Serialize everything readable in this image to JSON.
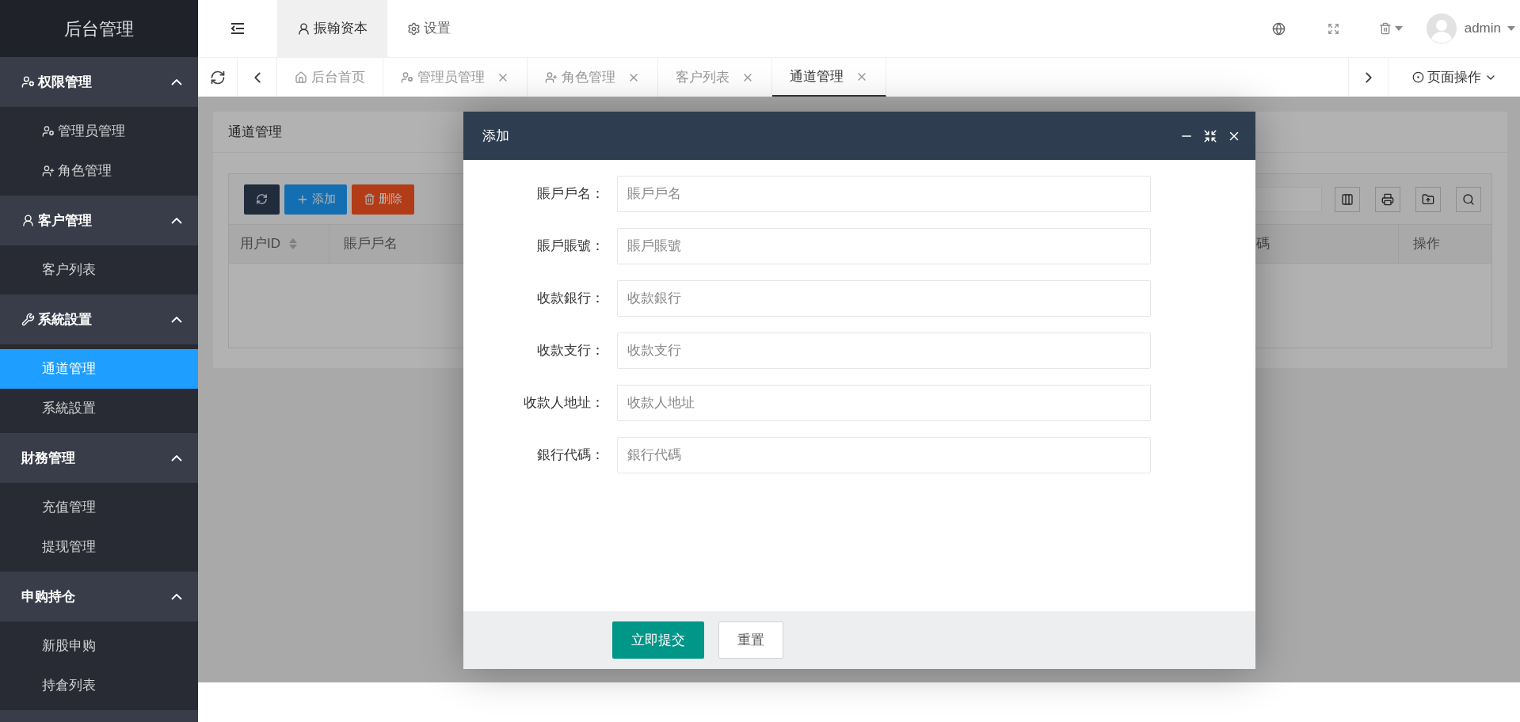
{
  "sidebar": {
    "logo": "后台管理",
    "groups": [
      {
        "label": "权限管理",
        "expanded": true,
        "items": [
          {
            "label": "管理员管理",
            "selected": false
          },
          {
            "label": "角色管理",
            "selected": false
          }
        ]
      },
      {
        "label": "客户管理",
        "expanded": true,
        "items": [
          {
            "label": "客户列表",
            "selected": false
          }
        ]
      },
      {
        "label": "系統設置",
        "expanded": true,
        "items": [
          {
            "label": "通道管理",
            "selected": true
          },
          {
            "label": "系統設置",
            "selected": false
          }
        ]
      },
      {
        "label": "財務管理",
        "expanded": true,
        "items": [
          {
            "label": "充值管理",
            "selected": false
          },
          {
            "label": "提现管理",
            "selected": false
          }
        ]
      },
      {
        "label": "申购持仓",
        "expanded": true,
        "items": [
          {
            "label": "新股申购",
            "selected": false
          },
          {
            "label": "持倉列表",
            "selected": false
          }
        ]
      }
    ]
  },
  "top_bar": {
    "nav": [
      {
        "label": "振翰资本",
        "selected": true
      },
      {
        "label": "设置",
        "selected": false
      }
    ],
    "user": "admin"
  },
  "page_tabs": {
    "tabs": [
      {
        "label": "后台首页",
        "selected": false,
        "closable": false
      },
      {
        "label": "管理员管理",
        "selected": false,
        "closable": true
      },
      {
        "label": "角色管理",
        "selected": false,
        "closable": true
      },
      {
        "label": "客户列表",
        "selected": false,
        "closable": true
      },
      {
        "label": "通道管理",
        "selected": true,
        "closable": true
      }
    ],
    "page_actions": "页面操作"
  },
  "card": {
    "title": "通道管理",
    "buttons": [
      {
        "kind": "refresh"
      },
      {
        "kind": "add",
        "label": "添加"
      },
      {
        "kind": "delete",
        "label": "删除"
      }
    ],
    "columns": [
      {
        "label": "用户ID",
        "sortable": true
      },
      {
        "label": "賬戶戶名",
        "sortable": false
      },
      {
        "label": "碼",
        "sortable": false
      },
      {
        "label": "操作",
        "sortable": false
      }
    ]
  },
  "dialog": {
    "title": "添加",
    "fields": [
      {
        "label": "賬戶戶名：",
        "placeholder": "賬戶戶名"
      },
      {
        "label": "賬戶賬號：",
        "placeholder": "賬戶賬號"
      },
      {
        "label": "收款銀行：",
        "placeholder": "收款銀行"
      },
      {
        "label": "收款支行：",
        "placeholder": "收款支行"
      },
      {
        "label": "收款人地址：",
        "placeholder": "收款人地址"
      },
      {
        "label": "銀行代碼：",
        "placeholder": "銀行代碼"
      }
    ],
    "submit": "立即提交",
    "reset": "重置"
  }
}
